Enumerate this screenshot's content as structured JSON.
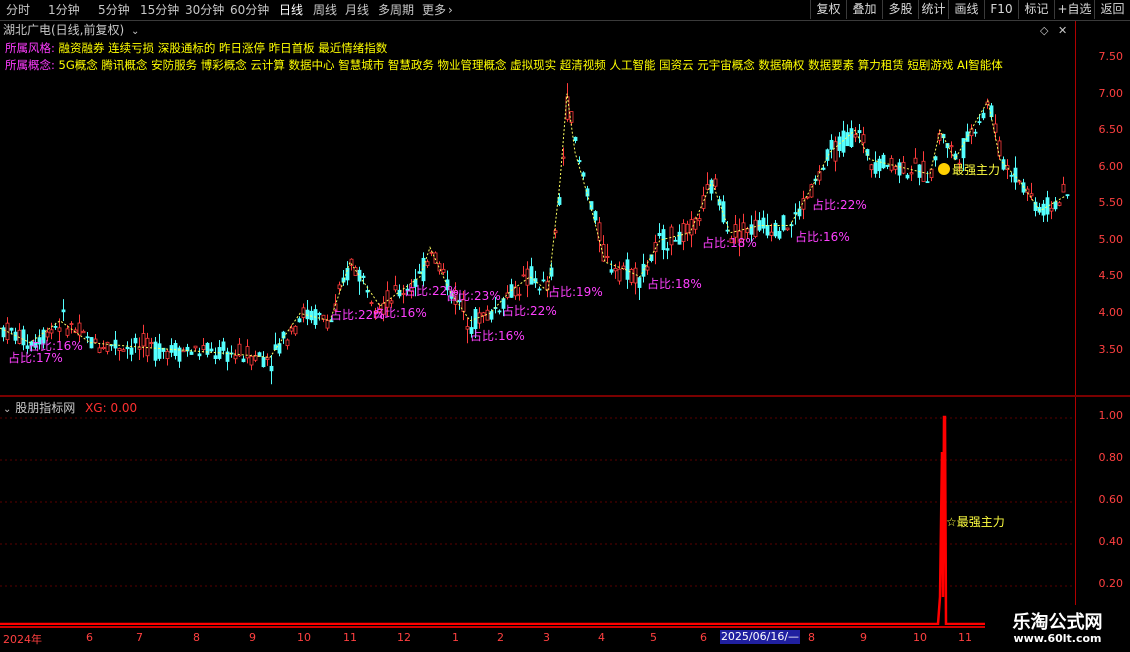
{
  "toolbar": {
    "periods": [
      "分时",
      "1分钟",
      "5分钟",
      "15分钟",
      "30分钟",
      "60分钟",
      "日线",
      "周线",
      "月线",
      "多周期",
      "更多"
    ],
    "active_period": "日线",
    "right_buttons": [
      "复权",
      "叠加",
      "多股",
      "统计",
      "画线",
      "F10",
      "标记",
      "+自选",
      "返回"
    ]
  },
  "stock": {
    "title": "湖北广电(日线,前复权)",
    "style_label": "所属风格:",
    "style_value": "融资融券 连续亏损 深股通标的 昨日涨停 昨日首板 最近情绪指数",
    "concept_label": "所属概念:",
    "concept_value": "5G概念 腾讯概念 安防服务 博彩概念 云计算 数据中心 智慧城市 智慧政务 物业管理概念 虚拟现实 超清视频 人工智能 国资云 元宇宙概念 数据确权 数据要素 算力租赁 短剧游戏 AI智能体"
  },
  "main_chart": {
    "y_ticks": [
      "7.50",
      "7.00",
      "6.50",
      "6.00",
      "5.50",
      "5.00",
      "4.50",
      "4.00",
      "3.50"
    ],
    "annotations": [
      "占比:17%",
      "占比:16%",
      "占比:22%",
      "占比:16%",
      "占比:22%",
      "占比:23%",
      "占比:16%",
      "占比:22%",
      "占比:19%",
      "占比:18%",
      "占比:18%",
      "占比:16%",
      "占比:22%"
    ],
    "signal_label": "最强主力"
  },
  "sub_chart": {
    "title": "股朋指标网",
    "xg_label": "XG: 0.00",
    "y_ticks": [
      "1.00",
      "0.80",
      "0.60",
      "0.40",
      "0.20"
    ],
    "signal_label": "☆最强主力"
  },
  "x_axis": {
    "labels": [
      "2024年",
      "6",
      "7",
      "8",
      "9",
      "10",
      "11",
      "12",
      "1",
      "2",
      "3",
      "4",
      "5",
      "6",
      "7",
      "8",
      "9",
      "10",
      "11"
    ],
    "cursor_date": "2025/06/16/—"
  },
  "watermark": {
    "name": "乐淘公式网",
    "url": "www.60lt.com"
  },
  "colors": {
    "up": "#ff3b3b",
    "down": "#54ffff",
    "concept_key": "#ff3cff",
    "concept_val": "#ffff00",
    "annotation": "#ff40ff",
    "signal": "#ff0000"
  }
}
